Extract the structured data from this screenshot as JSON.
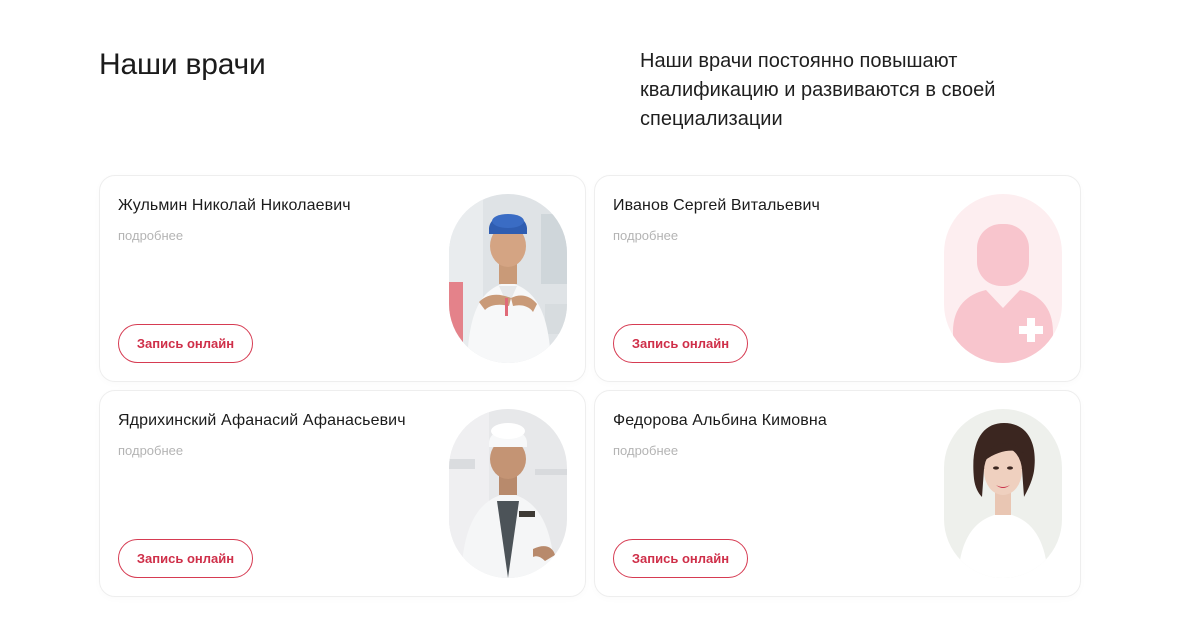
{
  "section": {
    "title": "Наши врачи",
    "intro": "Наши врачи постоянно повышают квалификацию и развиваются в своей специализации"
  },
  "doctors": [
    {
      "name": "Жульмин Николай Николаевич",
      "more_label": "подробнее",
      "button_label": "Запись онлайн",
      "photo": "doctor-photo-blue-cap-icon"
    },
    {
      "name": "Иванов Сергей Витальевич",
      "more_label": "подробнее",
      "button_label": "Запись онлайн",
      "photo": "placeholder-doctor-icon"
    },
    {
      "name": "Ядрихинский Афанасий Афанасьевич",
      "more_label": "подробнее",
      "button_label": "Запись онлайн",
      "photo": "doctor-photo-white-cap-icon"
    },
    {
      "name": "Федорова Альбина Кимовна",
      "more_label": "подробнее",
      "button_label": "Запись онлайн",
      "photo": "doctor-photo-woman-icon"
    }
  ],
  "colors": {
    "accent": "#cf2f49",
    "placeholder_bg": "#fdeef0",
    "placeholder_figure": "#f8c5cd",
    "muted_text": "#b4b4b4"
  }
}
